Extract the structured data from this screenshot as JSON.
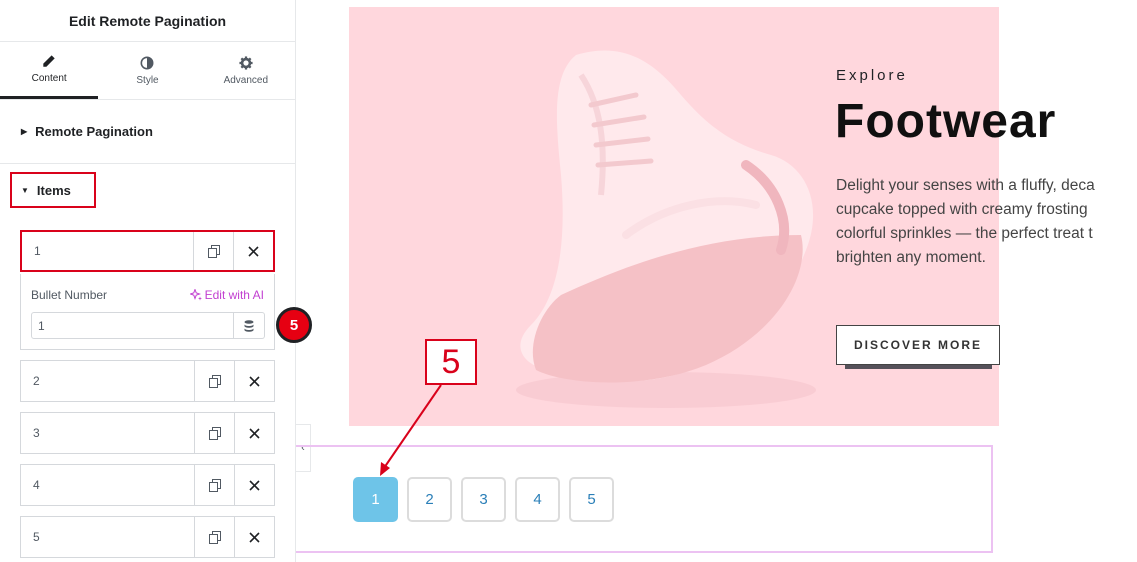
{
  "panel": {
    "title": "Edit Remote Pagination",
    "tabs": [
      {
        "label": "Content",
        "icon": "pencil-icon"
      },
      {
        "label": "Style",
        "icon": "half-circle-icon"
      },
      {
        "label": "Advanced",
        "icon": "gear-icon"
      }
    ],
    "section_remote": "Remote Pagination",
    "section_items": "Items",
    "items": [
      "1",
      "2",
      "3",
      "4",
      "5"
    ],
    "bullet_label": "Bullet Number",
    "edit_ai": "Edit with AI",
    "bullet_value": "1",
    "step_badge": "5"
  },
  "hero": {
    "eyebrow": "Explore",
    "title": "Footwear",
    "description": "Delight your senses with a fluffy, deca\ncupcake topped with creamy frosting\ncolorful sprinkles — the perfect treat t\nbrighten any moment.",
    "cta": "DISCOVER MORE"
  },
  "pagination": {
    "pages": [
      "1",
      "2",
      "3",
      "4",
      "5"
    ],
    "active": "1"
  },
  "annotation": {
    "label": "5"
  },
  "colors": {
    "accent_red": "#d9021b",
    "hero_bg": "#ffd7dd",
    "active_page": "#6ec4e8",
    "ai_purple": "#c23fd1"
  }
}
